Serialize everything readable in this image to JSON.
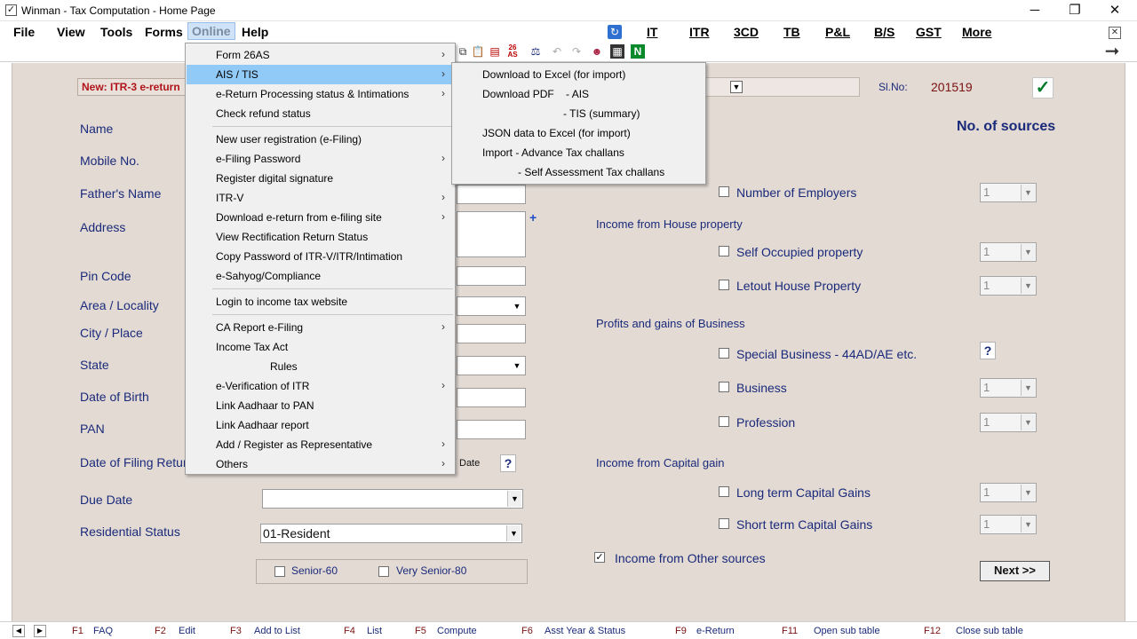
{
  "window": {
    "title": "Winman - Tax Computation - Home Page",
    "app_icon": "checkbox-icon",
    "minimize": "─",
    "restore": "❐",
    "close": "✕"
  },
  "menubar": {
    "items": [
      "File",
      "View",
      "Tools",
      "Forms",
      "Online",
      "Help"
    ],
    "active": "Online",
    "quick_links": [
      "IT",
      "ITR",
      "3CD",
      "TB",
      "P&L",
      "B/S",
      "GST",
      "More"
    ],
    "close_x": "✕",
    "arrow": "➞"
  },
  "toolbar": {
    "icons": [
      "copy-icon",
      "paste-icon",
      "pdf-icon",
      "26as-icon",
      "scale-icon",
      "undo-icon",
      "redo-icon",
      "user-icon",
      "film-icon",
      "n-icon"
    ],
    "n_label": "N",
    "badge_26as": "26 AS"
  },
  "form": {
    "return_type": "New: ITR-3 e-return",
    "slno_label": "Sl.No:",
    "slno_value": "201519",
    "check_symbol": "✓",
    "labels": {
      "name": "Name",
      "mobile": "Mobile No.",
      "father": "Father's Name",
      "address": "Address",
      "pin": "Pin Code",
      "area": "Area / Locality",
      "city": "City / Place",
      "state": "State",
      "dob": "Date of Birth",
      "pan": "PAN",
      "filing_date": "Date of Filing Return",
      "due_date": "Due Date",
      "residential": "Residential Status",
      "date_suffix": "Date"
    },
    "residential_value": "01-Resident",
    "senior_60": "Senior-60",
    "very_senior_80": "Very Senior-80",
    "plus": "+",
    "qmark": "?"
  },
  "sources": {
    "title": "No. of sources",
    "employers": "Number of Employers",
    "house_heading": "Income from House property",
    "self_occupied": "Self Occupied property",
    "letout": "Letout House Property",
    "business_heading": "Profits and gains of Business",
    "special": "Special Business - 44AD/AE etc.",
    "business": "Business",
    "profession": "Profession",
    "capital_heading": "Income from Capital gain",
    "ltcg": "Long term Capital Gains",
    "stcg": "Short term Capital Gains",
    "other_sources": "Income from Other sources",
    "spin_value": "1",
    "next": "Next >>"
  },
  "online_menu": {
    "items": [
      {
        "label": "Form 26AS",
        "sub": true
      },
      {
        "label": "AIS / TIS",
        "sub": true,
        "highlight": true
      },
      {
        "label": "e-Return Processing status & Intimations",
        "sub": true
      },
      {
        "label": "Check refund status",
        "sub": false
      },
      {
        "label": "New user registration (e-Filing)",
        "sub": false
      },
      {
        "label": "e-Filing Password",
        "sub": true
      },
      {
        "label": "Register digital signature",
        "sub": false
      },
      {
        "label": "ITR-V",
        "sub": true
      },
      {
        "label": "Download e-return from e-filing site",
        "sub": true
      },
      {
        "label": "View Rectification Return Status",
        "sub": false
      },
      {
        "label": "Copy Password of ITR-V/ITR/Intimation",
        "sub": false
      },
      {
        "label": "e-Sahyog/Compliance",
        "sub": false
      },
      {
        "label": "Login to income tax website",
        "sub": false
      },
      {
        "label": "CA Report e-Filing",
        "sub": true
      },
      {
        "label": "Income Tax Act",
        "sub": false
      },
      {
        "label": "Rules",
        "sub": false
      },
      {
        "label": "e-Verification of ITR",
        "sub": true
      },
      {
        "label": "Link Aadhaar to PAN",
        "sub": false
      },
      {
        "label": "Link Aadhaar report",
        "sub": false
      },
      {
        "label": "Add / Register as Representative",
        "sub": true
      },
      {
        "label": "Others",
        "sub": true
      }
    ],
    "sub_arrow": "›"
  },
  "ais_menu": {
    "items": [
      "Download to Excel (for import)",
      "Download PDF    - AIS",
      "- TIS (summary)",
      "JSON data to Excel (for import)",
      "Import - Advance Tax challans",
      "- Self Assessment Tax challans"
    ]
  },
  "statusbar": {
    "nav_left": "◀",
    "nav_right": "▶",
    "keys": [
      {
        "key": "F1",
        "label": "FAQ"
      },
      {
        "key": "F2",
        "label": "Edit"
      },
      {
        "key": "F3",
        "label": "Add to List"
      },
      {
        "key": "F4",
        "label": "List"
      },
      {
        "key": "F5",
        "label": "Compute"
      },
      {
        "key": "F6",
        "label": "Asst Year & Status"
      },
      {
        "key": "F9",
        "label": "e-Return"
      },
      {
        "key": "F11",
        "label": "Open sub table"
      },
      {
        "key": "F12",
        "label": "Close sub table"
      }
    ]
  }
}
